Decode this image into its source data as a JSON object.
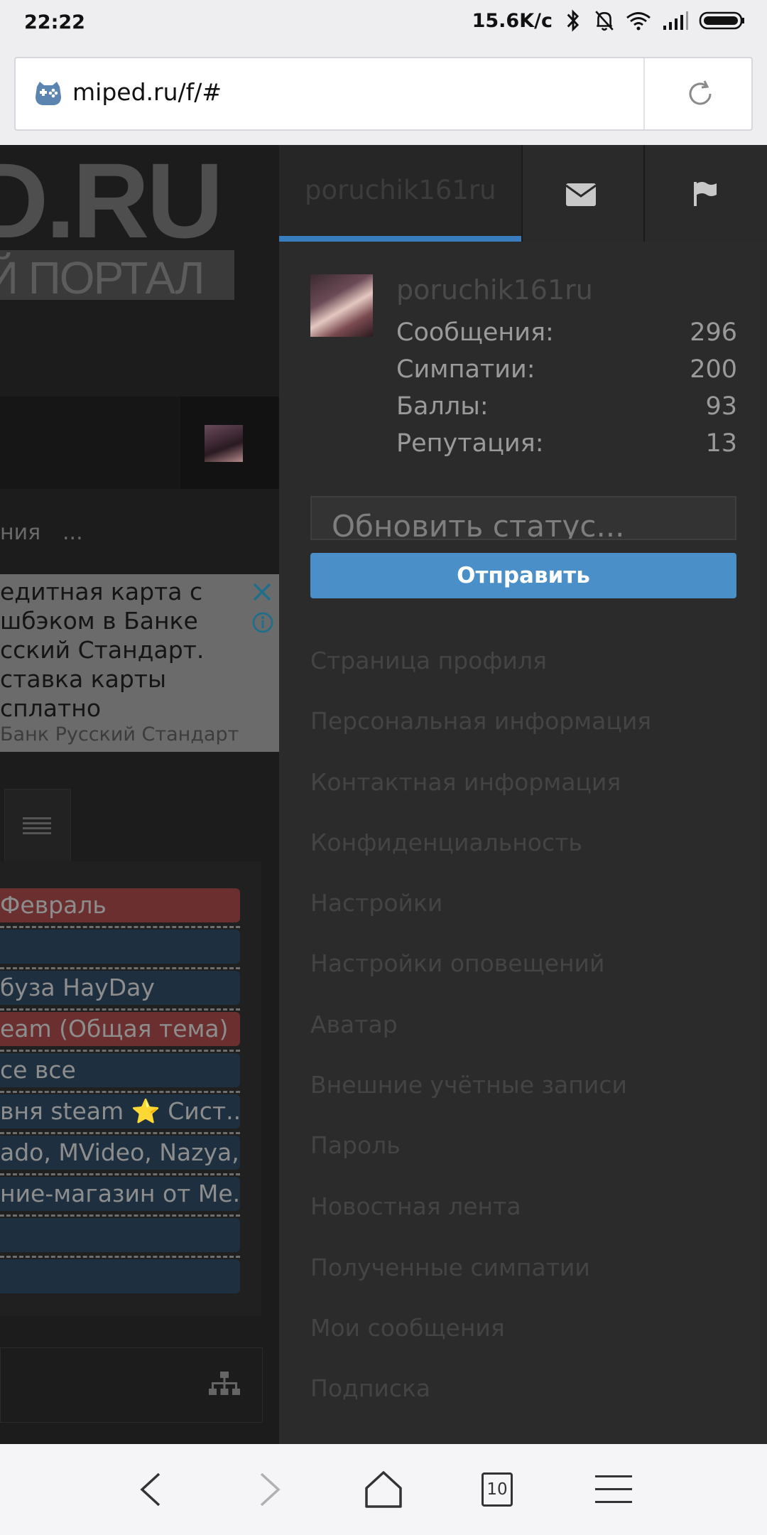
{
  "status_bar": {
    "time": "22:22",
    "speed": "15.6K/c"
  },
  "address_bar": {
    "url": "miped.ru/f/#"
  },
  "site": {
    "logo_main": "D.RU",
    "logo_sub": "Й ПОРТАЛ",
    "nav_text": "ния",
    "nav_more": "...",
    "ad": {
      "lines": [
        "едитная карта с",
        "шбэком в Банке",
        "сский Стандарт.",
        "ставка карты",
        "сплатно"
      ],
      "source": "Банк Русский Стандарт"
    },
    "topics": [
      {
        "title": "Февраль",
        "color": "red"
      },
      {
        "title": "",
        "color": "blue"
      },
      {
        "title": "буза HayDay",
        "color": "blue"
      },
      {
        "title": "eam (Общая тема)",
        "color": "red"
      },
      {
        "title": "се все",
        "color": "blue"
      },
      {
        "title": "вня steam ⭐ Сист...",
        "color": "blue"
      },
      {
        "title": "ado, MVideo, Nazya, ...",
        "color": "blue"
      },
      {
        "title": "ние-магазин от Ме...",
        "color": "blue"
      },
      {
        "title": "",
        "color": "blue"
      },
      {
        "title": "",
        "color": "blue"
      }
    ]
  },
  "panel": {
    "tab_username": "poruchik161ru",
    "username": "poruchik161ru",
    "stats": [
      {
        "label": "Сообщения:",
        "value": "296"
      },
      {
        "label": "Симпатии:",
        "value": "200"
      },
      {
        "label": "Баллы:",
        "value": "93"
      },
      {
        "label": "Репутация:",
        "value": "13"
      }
    ],
    "status_placeholder": "Обновить статус...",
    "send_label": "Отправить",
    "links": [
      "Страница профиля",
      "Персональная информация",
      "Контактная информация",
      "Конфиденциальность",
      "Настройки",
      "Настройки оповещений",
      "Аватар",
      "Внешние учётные записи",
      "Пароль",
      "Новостная лента",
      "Полученные симпатии",
      "Мои сообщения",
      "Подписка"
    ]
  },
  "toolbar": {
    "tab_count": "10"
  },
  "colors": {
    "accent": "#4a8fc8",
    "tab_underline": "#3a7dbf",
    "topic_red": "#6a2f2e",
    "topic_blue": "#1e3040"
  }
}
